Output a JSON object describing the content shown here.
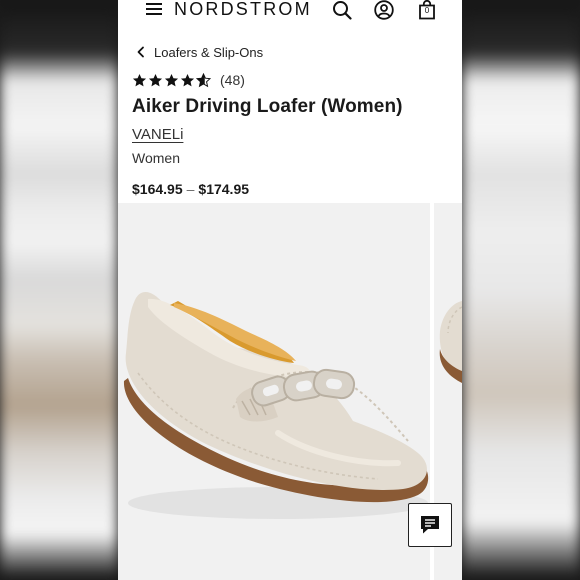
{
  "header": {
    "brand": "NORDSTROM",
    "menu_icon": "hamburger-menu-icon",
    "search_icon": "search-icon",
    "account_icon": "account-icon",
    "bag_icon": "shopping-bag-icon",
    "bag_count": "0"
  },
  "breadcrumb": {
    "back_icon": "chevron-left-icon",
    "label": "Loafers & Slip-Ons"
  },
  "product": {
    "rating": {
      "stars": 4.5,
      "count": "(48)"
    },
    "title": "Aiker Driving Loafer (Women)",
    "brand": "VANELi",
    "gender": "Women",
    "price_low": "$164.95",
    "price_sep": "–",
    "price_high": "$174.95"
  },
  "gallery": {
    "current_image": "cream-leather-driving-loafer-with-chain-ornament"
  },
  "chat": {
    "icon": "chat-bubble-icon"
  },
  "colors": {
    "star": "#111111",
    "gallery_bg": "#f1f1f1",
    "shoe_leather": "#e3dcd1",
    "shoe_lining": "#d99a2e",
    "shoe_sole": "#8a5a35"
  }
}
